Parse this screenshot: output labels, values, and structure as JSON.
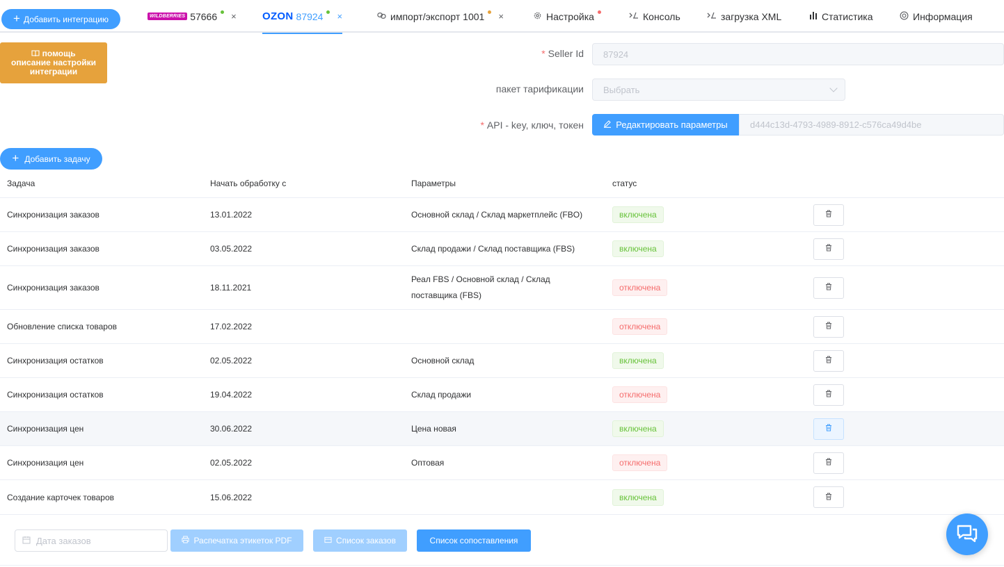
{
  "topbar": {
    "add_integration": "Добавить интеграцию",
    "tabs": [
      {
        "logo": "WILDBERRIES",
        "label": "57666",
        "dot_color": "#67c23a",
        "close": "×"
      },
      {
        "logo": "OZON",
        "label": "87924",
        "dot_color": "#67c23a",
        "close": "×",
        "active": true
      },
      {
        "icon": "link-icon",
        "label": "импорт/экспорт 1001",
        "dot_color": "#e6a23c",
        "close": "×"
      },
      {
        "icon": "gear-icon",
        "label": "Настройка",
        "dot_color": "#f56c6c"
      },
      {
        "icon": "console-icon",
        "label": "Консоль"
      },
      {
        "icon": "console-icon",
        "label": "загрузка XML"
      },
      {
        "icon": "bar-chart-icon",
        "label": "Статистика"
      },
      {
        "icon": "info-icon",
        "label": "Информация"
      }
    ]
  },
  "help": {
    "line1": "помощь",
    "line2": "описание настройки",
    "line3": "интеграции"
  },
  "form": {
    "seller_id_label": "Seller Id",
    "seller_id_value": "87924",
    "tariff_label": "пакет тарификации",
    "tariff_placeholder": "Выбрать",
    "api_label": "API - key, ключ, токен",
    "edit_button": "Редактировать параметры",
    "api_value": "d444c13d-4793-4989-8912-c576ca49d4be",
    "required_mark": "*"
  },
  "add_task": "Добавить задачу",
  "table": {
    "headers": [
      "Задача",
      "Начать обработку с",
      "Параметры",
      "статус"
    ],
    "rows": [
      {
        "task": "Синхронизация заказов",
        "start": "13.01.2022",
        "params": "Основной склад / Склад маркетплейс (FBO)",
        "status": "включена",
        "on": true
      },
      {
        "task": "Синхронизация заказов",
        "start": "03.05.2022",
        "params": "Склад продажи / Склад поставщика (FBS)",
        "status": "включена",
        "on": true
      },
      {
        "task": "Синхронизация заказов",
        "start": "18.11.2021",
        "params": "Реал FBS / Основной склад / Склад поставщика (FBS)",
        "status": "отключена",
        "on": false
      },
      {
        "task": "Обновление списка товаров",
        "start": "17.02.2022",
        "params": "",
        "status": "отключена",
        "on": false
      },
      {
        "task": "Синхронизация остатков",
        "start": "02.05.2022",
        "params": "Основной склад",
        "status": "включена",
        "on": true
      },
      {
        "task": "Синхронизация остатков",
        "start": "19.04.2022",
        "params": "Склад продажи",
        "status": "отключена",
        "on": false
      },
      {
        "task": "Синхронизация цен",
        "start": "30.06.2022",
        "params": "Цена новая",
        "status": "включена",
        "on": true
      },
      {
        "task": "Синхронизация цен",
        "start": "02.05.2022",
        "params": "Оптовая",
        "status": "отключена",
        "on": false
      },
      {
        "task": "Создание карточек товаров",
        "start": "15.06.2022",
        "params": "",
        "status": "включена",
        "on": true
      }
    ]
  },
  "bottom": {
    "date_placeholder": "Дата заказов",
    "print_labels": "Распечатка этикеток PDF",
    "orders_list": "Список заказов",
    "mapping_list": "Список сопоставления"
  },
  "colors": {
    "primary": "#409eff",
    "warning": "#e6a23c",
    "success": "#67c23a",
    "danger": "#f56c6c"
  }
}
